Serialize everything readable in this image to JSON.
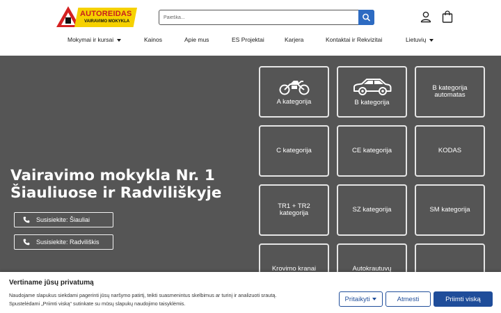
{
  "logo": {
    "title": "AUTOREIDAS",
    "subtitle": "VAIRAVIMO MOKYKLA"
  },
  "search": {
    "placeholder": "Paieška..."
  },
  "nav": {
    "items": [
      {
        "label": "Mokymai ir kursai",
        "dropdown": true
      },
      {
        "label": "Kainos",
        "dropdown": false
      },
      {
        "label": "Apie mus",
        "dropdown": false
      },
      {
        "label": "ES Projektai",
        "dropdown": false
      },
      {
        "label": "Karjera",
        "dropdown": false
      },
      {
        "label": "Kontaktai ir Rekvizitai",
        "dropdown": false
      },
      {
        "label": "Lietuvių",
        "dropdown": true
      }
    ]
  },
  "hero": {
    "title_line1": "Vairavimo mokykla Nr. 1",
    "title_line2": "Šiauliuose ir Radviliškyje",
    "buttons": [
      {
        "label": "Susisiekite: Šiauliai",
        "icon": "phone-icon"
      },
      {
        "label": "Susisiekite: Radviliškis",
        "icon": "phone-icon"
      }
    ]
  },
  "tiles": [
    {
      "label": "A kategorija",
      "icon": "motorcycle-icon"
    },
    {
      "label": "B kategorija",
      "icon": "car-icon"
    },
    {
      "label": "B kategorija automatas",
      "icon": ""
    },
    {
      "label": "C kategorija",
      "icon": ""
    },
    {
      "label": "CE kategorija",
      "icon": ""
    },
    {
      "label": "KODAS",
      "icon": ""
    },
    {
      "label": "TR1 + TR2 kategorija",
      "icon": ""
    },
    {
      "label": "SZ kategorija",
      "icon": ""
    },
    {
      "label": "SM kategorija",
      "icon": ""
    },
    {
      "label": "Krovimo kranai",
      "icon": ""
    },
    {
      "label": "Autokrautuvų",
      "icon": ""
    },
    {
      "label": "",
      "icon": ""
    }
  ],
  "cookie": {
    "title": "Vertiname jūsų privatumą",
    "text_line1": "Naudojame slapukus siekdami pagerinti jūsų naršymo patirtį, teikti suasmenintus skelbimus ar turinį ir analizuoti srautą.",
    "text_line2": "Spustelėdami „Priimti viską“ sutinkate su mūsų slapukų naudojimo taisyklėmis.",
    "customize_label": "Pritaikyti",
    "reject_label": "Atmesti",
    "accept_label": "Priimti viską"
  },
  "colors": {
    "brand_blue": "#1f4d9a",
    "search_blue": "#2d6bc2",
    "hero_bg": "#555555",
    "logo_red": "#c81e1e",
    "logo_yellow": "#f6d100"
  }
}
